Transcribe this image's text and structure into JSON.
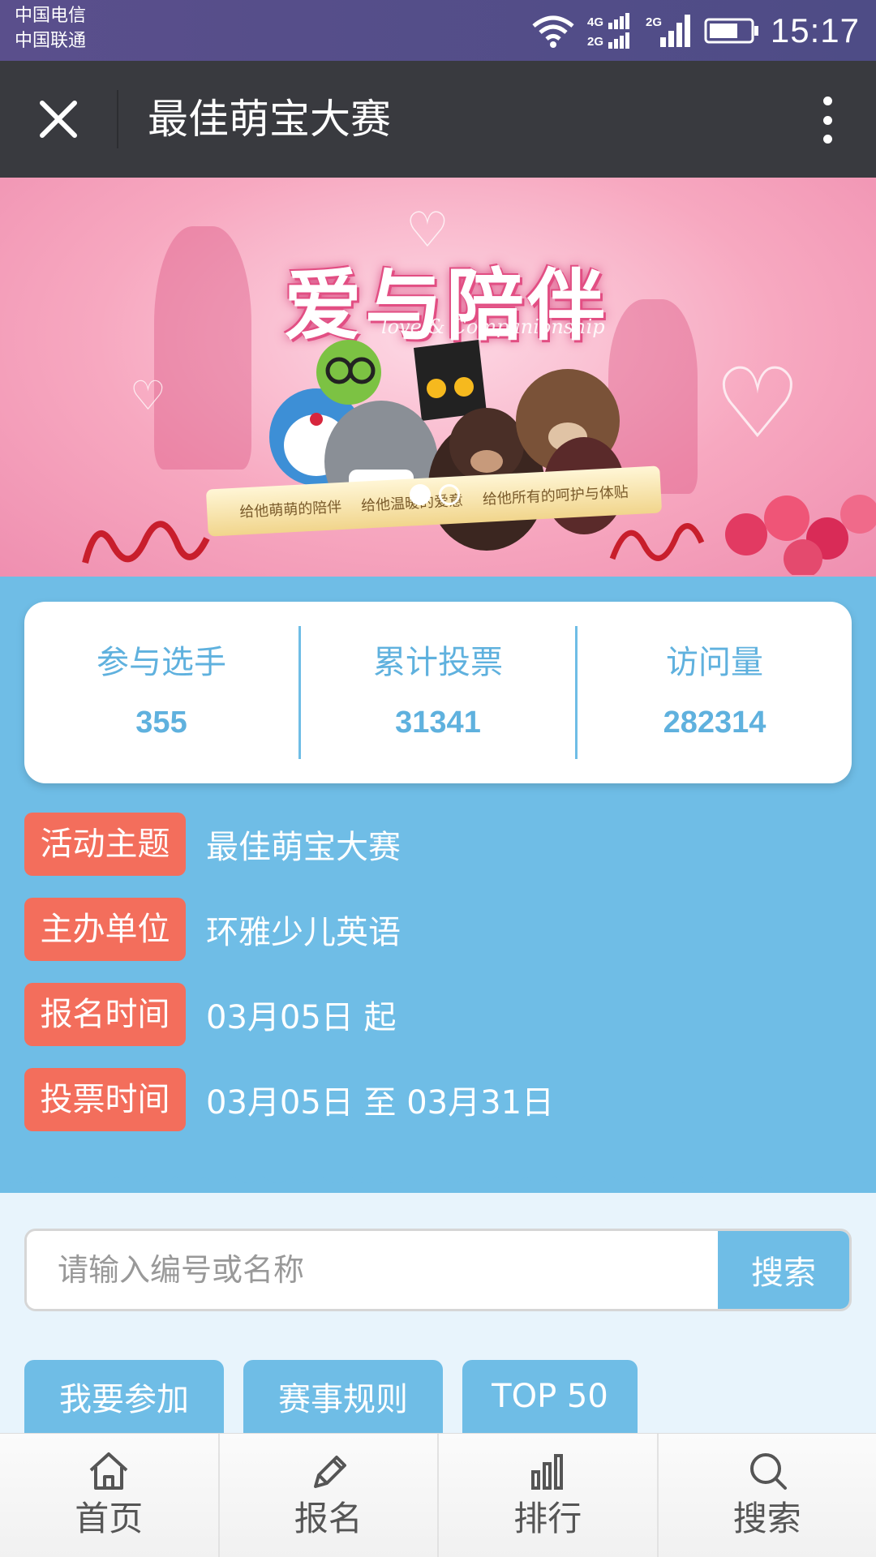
{
  "status_bar": {
    "carrier_1": "中国电信",
    "carrier_2": "中国联通",
    "net_1": "4G",
    "net_1b": "2G",
    "net_2": "2G",
    "time": "15:17"
  },
  "title_bar": {
    "title": "最佳萌宝大赛"
  },
  "banner": {
    "title": "爱与陪伴",
    "subtitle": "love & Companionship",
    "ribbon_texts": [
      "给他萌萌的陪伴",
      "给他温暖的爱意",
      "给他所有的呵护与体贴"
    ]
  },
  "stats": [
    {
      "label": "参与选手",
      "value": "355"
    },
    {
      "label": "累计投票",
      "value": "31341"
    },
    {
      "label": "访问量",
      "value": "282314"
    }
  ],
  "info": [
    {
      "tag": "活动主题",
      "value": "最佳萌宝大赛"
    },
    {
      "tag": "主办单位",
      "value": "环雅少儿英语"
    },
    {
      "tag": "报名时间",
      "value": "03月05日 起"
    },
    {
      "tag": "投票时间",
      "value": "03月05日 至 03月31日"
    }
  ],
  "search": {
    "placeholder": "请输入编号或名称",
    "button": "搜索"
  },
  "actions": [
    "我要参加",
    "赛事规则",
    "TOP 50"
  ],
  "bottom_nav": [
    {
      "label": "首页",
      "icon": "home-icon"
    },
    {
      "label": "报名",
      "icon": "pencil-icon"
    },
    {
      "label": "排行",
      "icon": "bar-chart-icon"
    },
    {
      "label": "搜索",
      "icon": "search-icon"
    }
  ],
  "colors": {
    "section_blue": "#6fbde6",
    "tag_red": "#f36e5c",
    "title_bar": "#393a3f"
  }
}
